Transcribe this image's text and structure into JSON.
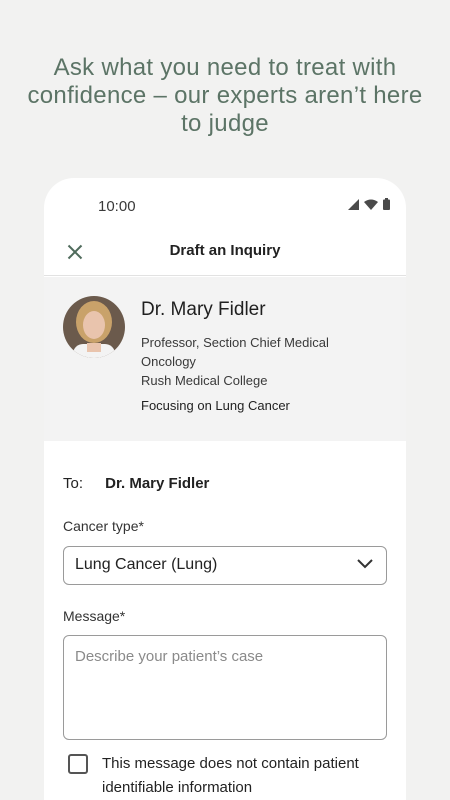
{
  "headline": "Ask what you need to treat with confidence – our experts aren’t here to judge",
  "status": {
    "time": "10:00",
    "icons": [
      "signal-icon",
      "wifi-icon",
      "battery-icon"
    ]
  },
  "appbar": {
    "close_icon": "close-icon",
    "title": "Draft an Inquiry"
  },
  "expert": {
    "name": "Dr. Mary Fidler",
    "title": "Professor, Section Chief Medical Oncology",
    "institution": "Rush Medical College",
    "focus": "Focusing on Lung Cancer"
  },
  "form": {
    "to_label": "To:",
    "to_value": "Dr. Mary Fidler",
    "cancer_type_label": "Cancer type*",
    "cancer_type_value": "Lung Cancer (Lung)",
    "message_label": "Message*",
    "message_placeholder": "Describe your patient’s case",
    "checkbox_label": "This message does not contain patient identifiable information",
    "checkbox_checked": false
  },
  "colors": {
    "headline": "#5c7466",
    "background": "#f2f2f1",
    "card": "#f3f3f3"
  }
}
